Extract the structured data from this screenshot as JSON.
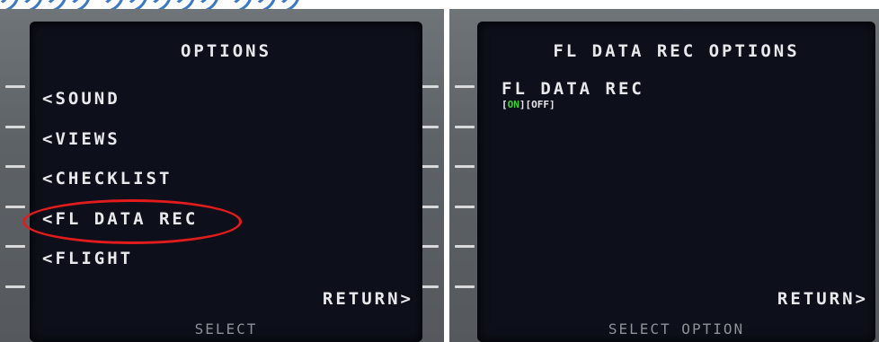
{
  "header_fragment": "ググググ グググググ グググ",
  "left_panel": {
    "title": "OPTIONS",
    "menu_items": [
      "<SOUND",
      "<VIEWS",
      "<CHECKLIST",
      "<FL DATA REC",
      "<FLIGHT"
    ],
    "return_label": "RETURN>",
    "scratchpad": "SELECT",
    "highlight_color": "#e21c1c"
  },
  "right_panel": {
    "title": "FL DATA REC OPTIONS",
    "field_label": "FL DATA REC",
    "options": {
      "open_bracket_1": "[",
      "on": "ON",
      "close_open": "][",
      "off": "OFF",
      "close_bracket": "]",
      "on_color": "#39d22f"
    },
    "return_label": "RETURN>",
    "scratchpad": "SELECT OPTION"
  }
}
